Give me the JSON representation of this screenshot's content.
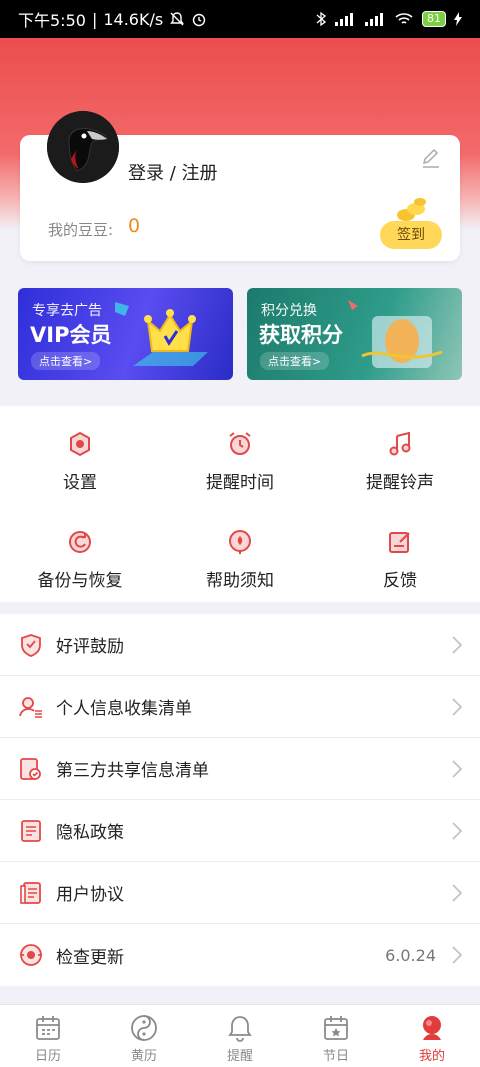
{
  "status_bar": {
    "time": "下午5:50",
    "net_speed": "14.6K/s",
    "battery": "81"
  },
  "profile": {
    "login_text": "登录 / 注册",
    "beans_label": "我的豆豆:",
    "beans_value": "0",
    "signin_label": "签到"
  },
  "banners": {
    "vip": {
      "subtitle": "专享去广告",
      "title": "VIP会员",
      "link": "点击查看>"
    },
    "points": {
      "subtitle": "积分兑换",
      "title": "获取积分",
      "link": "点击查看>"
    }
  },
  "grid": [
    {
      "label": "设置",
      "icon": "settings-icon"
    },
    {
      "label": "提醒时间",
      "icon": "alarm-clock-icon"
    },
    {
      "label": "提醒铃声",
      "icon": "music-note-icon"
    },
    {
      "label": "备份与恢复",
      "icon": "backup-icon"
    },
    {
      "label": "帮助须知",
      "icon": "help-icon"
    },
    {
      "label": "反馈",
      "icon": "feedback-icon"
    }
  ],
  "menu": [
    {
      "label": "好评鼓励",
      "icon": "heart-shield-icon",
      "value": ""
    },
    {
      "label": "个人信息收集清单",
      "icon": "person-list-icon",
      "value": ""
    },
    {
      "label": "第三方共享信息清单",
      "icon": "share-doc-icon",
      "value": ""
    },
    {
      "label": "隐私政策",
      "icon": "document-icon",
      "value": ""
    },
    {
      "label": "用户协议",
      "icon": "agreement-icon",
      "value": ""
    },
    {
      "label": "检查更新",
      "icon": "refresh-icon",
      "value": "6.0.24"
    }
  ],
  "tabs": [
    {
      "label": "日历",
      "icon": "calendar-icon",
      "active": false
    },
    {
      "label": "黄历",
      "icon": "yin-yang-icon",
      "active": false
    },
    {
      "label": "提醒",
      "icon": "bell-icon",
      "active": false
    },
    {
      "label": "节日",
      "icon": "festival-calendar-icon",
      "active": false
    },
    {
      "label": "我的",
      "icon": "user-icon",
      "active": true
    }
  ],
  "colors": {
    "accent": "#e23b3b",
    "beans": "#f08a1b",
    "signin": "#ffd85a"
  }
}
